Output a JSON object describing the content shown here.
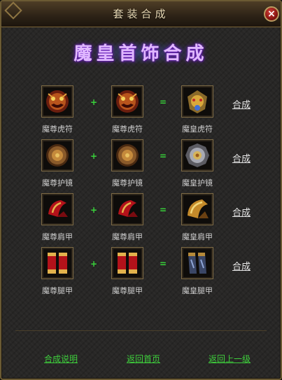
{
  "window": {
    "title": "套装合成",
    "close_label": "×"
  },
  "heading": "魔皇首饰合成",
  "rows": [
    {
      "ingredient_a": {
        "name": "魔尊虎符",
        "icon": "demon-tiger-tally-icon"
      },
      "ingredient_b": {
        "name": "魔尊虎符",
        "icon": "demon-tiger-tally-icon"
      },
      "result": {
        "name": "魔皇虎符",
        "icon": "emperor-tiger-tally-icon"
      },
      "plus": "+",
      "equals": "=",
      "action": "合成"
    },
    {
      "ingredient_a": {
        "name": "魔尊护镜",
        "icon": "demon-mirror-icon"
      },
      "ingredient_b": {
        "name": "魔尊护镜",
        "icon": "demon-mirror-icon"
      },
      "result": {
        "name": "魔皇护镜",
        "icon": "emperor-mirror-icon"
      },
      "plus": "+",
      "equals": "=",
      "action": "合成"
    },
    {
      "ingredient_a": {
        "name": "魔尊肩甲",
        "icon": "demon-shoulder-icon"
      },
      "ingredient_b": {
        "name": "魔尊肩甲",
        "icon": "demon-shoulder-icon"
      },
      "result": {
        "name": "魔皇肩甲",
        "icon": "emperor-shoulder-icon"
      },
      "plus": "+",
      "equals": "=",
      "action": "合成"
    },
    {
      "ingredient_a": {
        "name": "魔尊腿甲",
        "icon": "demon-leg-armor-icon"
      },
      "ingredient_b": {
        "name": "魔尊腿甲",
        "icon": "demon-leg-armor-icon"
      },
      "result": {
        "name": "魔皇腿甲",
        "icon": "emperor-leg-armor-icon"
      },
      "plus": "+",
      "equals": "=",
      "action": "合成"
    }
  ],
  "footer": {
    "help": "合成说明",
    "home": "返回首页",
    "back": "返回上一级"
  },
  "colors": {
    "accent_green": "#3ecf3c",
    "heading_purple": "#e0b7ff",
    "frame_gold": "#7d6a45"
  }
}
